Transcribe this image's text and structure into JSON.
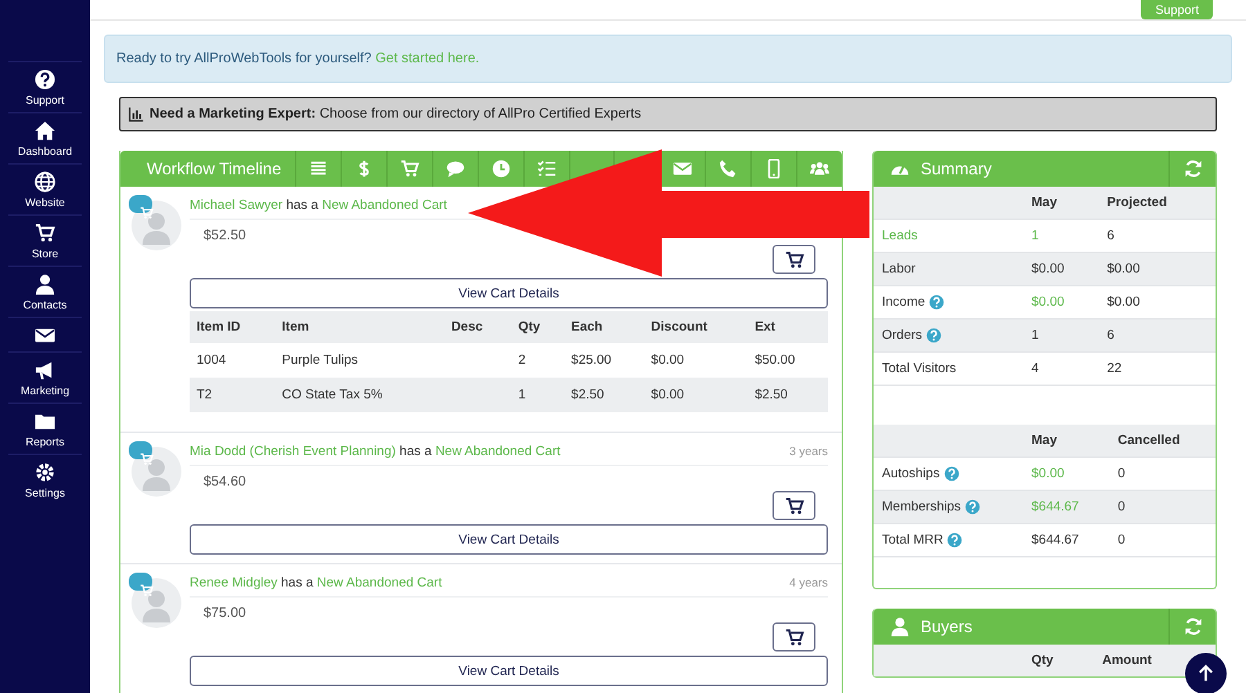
{
  "header": {
    "support_button": "Support"
  },
  "sidebar": {
    "items": [
      {
        "kind": "labelled",
        "label": "Support"
      },
      {
        "kind": "labelled",
        "label": "Dashboard"
      },
      {
        "kind": "labelled",
        "label": "Website"
      },
      {
        "kind": "labelled",
        "label": "Store"
      },
      {
        "kind": "labelled",
        "label": "Contacts"
      },
      {
        "kind": "icon"
      },
      {
        "kind": "labelled",
        "label": "Marketing"
      },
      {
        "kind": "labelled",
        "label": "Reports"
      },
      {
        "kind": "labelled",
        "label": "Settings"
      }
    ]
  },
  "banner": {
    "text": "Ready to try AllProWebTools for yourself?",
    "link": "Get started here."
  },
  "marketing_bar": {
    "text": "**Need a Marketing Expert:** Choose from our directory of AllPro Certified Experts"
  },
  "timeline": {
    "title": "Workflow Timeline",
    "entries": [
      {
        "contact": "Michael Sawyer",
        "verb": "has a",
        "event": "New Abandoned Cart",
        "amount": "$52.50",
        "button": "View Cart Details",
        "columns": [
          "Item ID",
          "Item",
          "Desc",
          "Qty",
          "Each",
          "Discount",
          "Ext"
        ],
        "rows": [
          [
            "1004",
            "Purple Tulips",
            "",
            "2",
            "$25.00",
            "$0.00",
            "$50.00"
          ],
          [
            "T2",
            "CO State Tax 5%",
            "",
            "1",
            "$2.50",
            "$0.00",
            "$2.50"
          ]
        ]
      },
      {
        "contact": "Mia Dodd (Cherish Event Planning)",
        "verb": "has a",
        "event": "New Abandoned Cart",
        "time": "3 years",
        "amount": "$54.60",
        "button": "View Cart Details"
      },
      {
        "contact": "Renee Midgley",
        "verb": "has a",
        "event": "New Abandoned Cart",
        "time": "4 years",
        "amount": "$75.00",
        "button": "View Cart Details"
      }
    ]
  },
  "summary": {
    "title": "Summary",
    "tables": [
      {
        "columns": [
          "May",
          "Projected"
        ],
        "rows": [
          {
            "label": "Leads",
            "help": false,
            "highlighted": true,
            "values": [
              {
                "text": "1",
                "highlighted": true
              },
              {
                "text": "6",
                "highlighted": false
              }
            ]
          },
          {
            "label": "Labor",
            "help": false,
            "highlighted": false,
            "values": [
              {
                "text": "$0.00",
                "highlighted": false
              },
              {
                "text": "$0.00",
                "highlighted": false
              }
            ]
          },
          {
            "label": "Income",
            "help": true,
            "highlighted": false,
            "values": [
              {
                "text": "$0.00",
                "highlighted": true
              },
              {
                "text": "$0.00",
                "highlighted": false
              }
            ]
          },
          {
            "label": "Orders",
            "help": true,
            "highlighted": false,
            "values": [
              {
                "text": "1",
                "highlighted": false
              },
              {
                "text": "6",
                "highlighted": false
              }
            ]
          },
          {
            "label": "Total Visitors",
            "help": false,
            "highlighted": false,
            "values": [
              {
                "text": "4",
                "highlighted": false
              },
              {
                "text": "22",
                "highlighted": false
              }
            ]
          }
        ]
      },
      {
        "columns": [
          "May",
          "Cancelled"
        ],
        "rows": [
          {
            "label": "Autoships",
            "help": true,
            "highlighted": false,
            "values": [
              {
                "text": "$0.00",
                "highlighted": true
              },
              {
                "text": "0",
                "highlighted": false
              }
            ]
          },
          {
            "label": "Memberships",
            "help": true,
            "highlighted": false,
            "values": [
              {
                "text": "$644.67",
                "highlighted": true
              },
              {
                "text": "0",
                "highlighted": false
              }
            ]
          },
          {
            "label": "Total MRR",
            "help": true,
            "highlighted": false,
            "values": [
              {
                "text": "$644.67",
                "highlighted": false
              },
              {
                "text": "0",
                "highlighted": false
              }
            ]
          }
        ]
      }
    ]
  },
  "buyers": {
    "title": "Buyers",
    "columns": [
      "Qty",
      "Amount"
    ]
  }
}
